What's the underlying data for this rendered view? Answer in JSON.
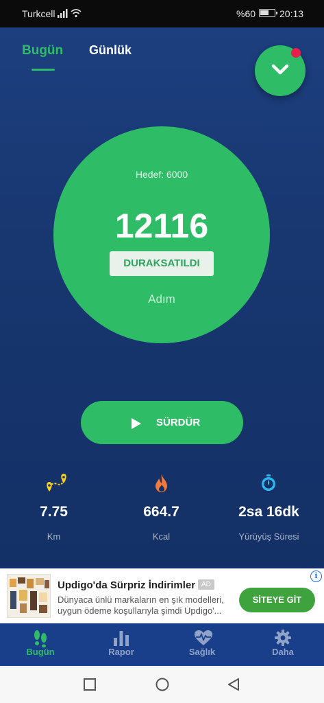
{
  "status_bar": {
    "carrier": "Turkcell",
    "battery": "%60",
    "time": "20:13"
  },
  "tabs": {
    "today": "Bugün",
    "daily": "Günlük"
  },
  "goal_text": "Hedef: 6000",
  "steps": "12116",
  "paused_label": "DURAKSATILDI",
  "steps_unit": "Adım",
  "resume_label": "SÜRDÜR",
  "stats": [
    {
      "value": "7.75",
      "label": "Km",
      "icon": "route-pin-icon"
    },
    {
      "value": "664.7",
      "label": "Kcal",
      "icon": "flame-icon"
    },
    {
      "value": "2sa 16dk",
      "label": "Yürüyüş Süresi",
      "icon": "stopwatch-icon"
    }
  ],
  "ad": {
    "title": "Updigo'da Sürpriz İndirimler",
    "badge": "AD",
    "line1": "Dünyaca ünlü markaların en şık modelleri,",
    "line2": "uygun ödeme koşullarıyla şimdi Updigo'...",
    "button": "SİTEYE GİT",
    "info": "i"
  },
  "bottom_nav": [
    {
      "label": "Bugün",
      "icon": "footsteps-icon",
      "active": true
    },
    {
      "label": "Rapor",
      "icon": "bar-chart-icon",
      "active": false
    },
    {
      "label": "Sağlık",
      "icon": "heart-pulse-icon",
      "active": false
    },
    {
      "label": "Daha",
      "icon": "gear-icon",
      "active": false
    }
  ],
  "colors": {
    "accent": "#2ebd66",
    "background": "#1c3f7e",
    "nav_bg": "#1a3f8a",
    "notification": "#ea1f4b"
  }
}
